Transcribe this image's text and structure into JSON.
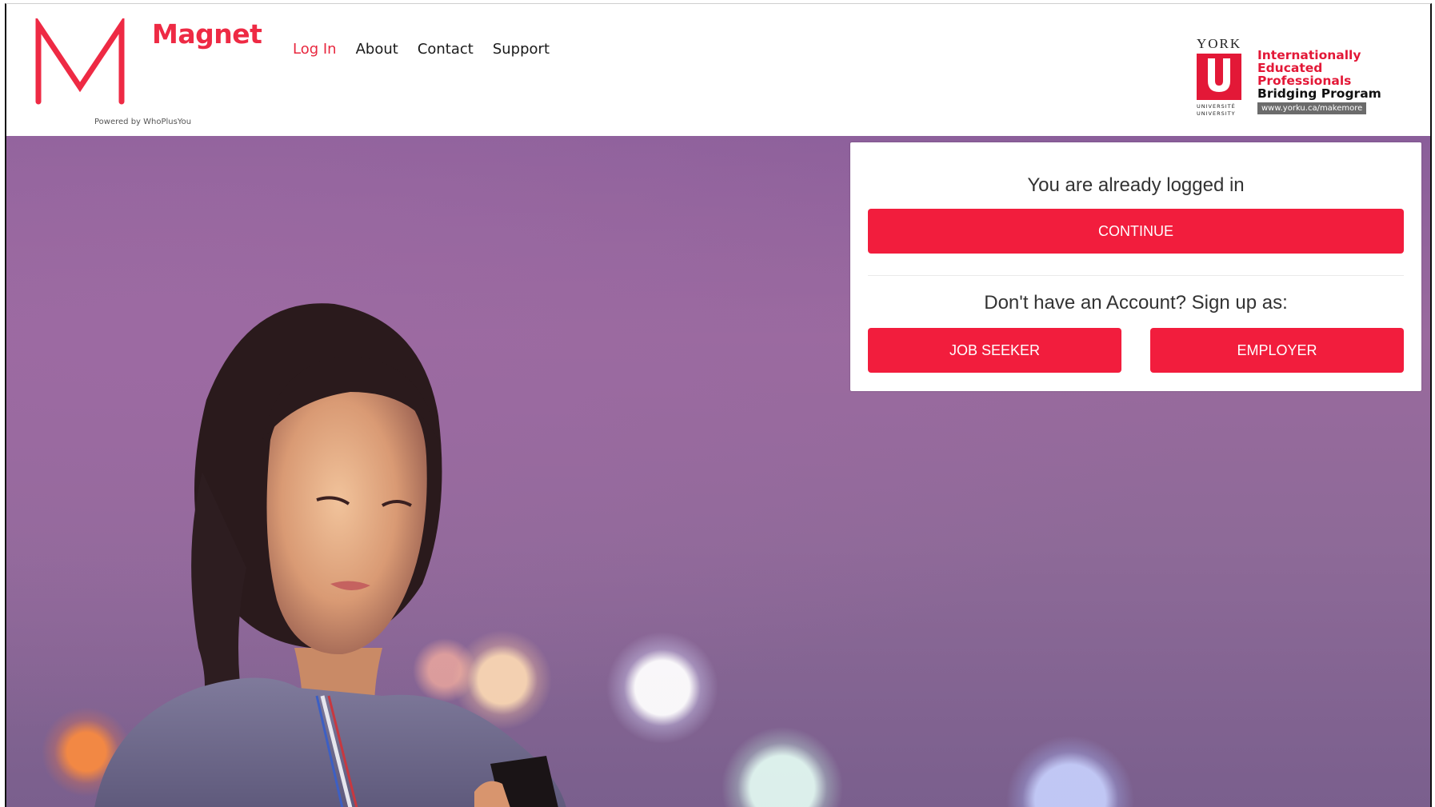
{
  "header": {
    "brand_name": "Magnet",
    "powered_by": "Powered by WhoPlusYou",
    "nav": [
      {
        "label": "Log In",
        "active": true
      },
      {
        "label": "About",
        "active": false
      },
      {
        "label": "Contact",
        "active": false
      },
      {
        "label": "Support",
        "active": false
      }
    ],
    "partner": {
      "york": "YORK",
      "york_u": "U",
      "york_sub_1": "UNIVERSITÉ",
      "york_sub_2": "UNIVERSITY",
      "program_line_1": "Internationally",
      "program_line_2": "Educated",
      "program_line_3": "Professionals",
      "program_line_4": "Bridging Program",
      "program_url": "www.yorku.ca/makemore"
    }
  },
  "login_card": {
    "status_message": "You are already logged in",
    "continue_label": "CONTINUE",
    "signup_prompt": "Don't have an Account? Sign up as:",
    "job_seeker_label": "JOB SEEKER",
    "employer_label": "EMPLOYER"
  },
  "colors": {
    "brand_red": "#ee2a44",
    "button_red": "#f21d3d",
    "york_red": "#e31837",
    "hero_purple": "#8a5e9a"
  },
  "icons": {
    "logo": "magnet-m-logo",
    "partner": "york-u-logo"
  }
}
